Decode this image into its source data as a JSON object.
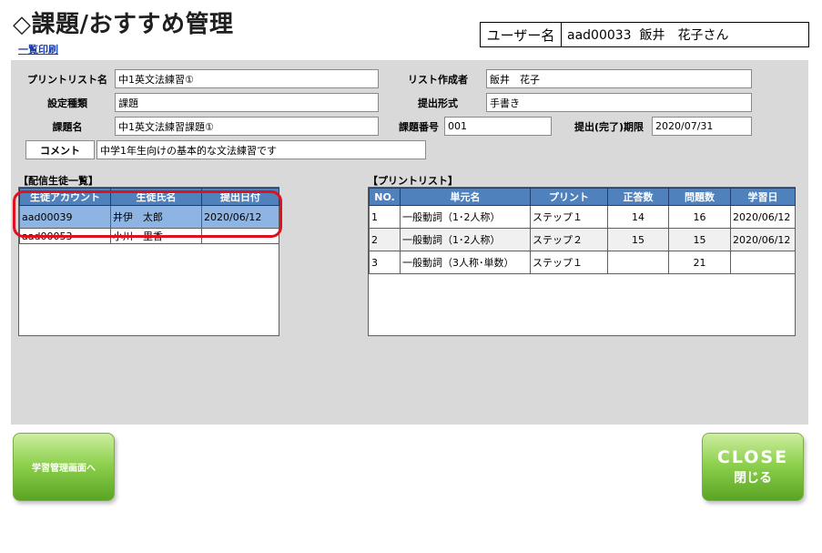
{
  "header": {
    "title": "◇課題/おすすめ管理",
    "print_link": "一覧印刷"
  },
  "user": {
    "label": "ユーザー名",
    "value": "aad00033  飯井　花子さん"
  },
  "form": {
    "print_list_name": {
      "label": "プリントリスト名",
      "value": "中1英文法練習①"
    },
    "creator": {
      "label": "リスト作成者",
      "value": "飯井　花子"
    },
    "setting_type": {
      "label": "設定種類",
      "value": "課題"
    },
    "submit_format": {
      "label": "提出形式",
      "value": "手書き"
    },
    "task_name": {
      "label": "課題名",
      "value": "中1英文法練習課題①"
    },
    "task_number": {
      "label": "課題番号",
      "value": "001"
    },
    "deadline": {
      "label": "提出(完了)期限",
      "value": "2020/07/31"
    },
    "comment": {
      "label": "コメント",
      "value": "中学1年生向けの基本的な文法練習です"
    }
  },
  "students": {
    "section_label": "【配信生徒一覧】",
    "headers": [
      "生徒アカウント",
      "生徒氏名",
      "提出日付"
    ],
    "rows": [
      [
        "aad00039",
        "井伊　太郎",
        "2020/06/12"
      ],
      [
        "aad00053",
        "小川　里香",
        ""
      ]
    ],
    "selected_index": 0
  },
  "print_list": {
    "section_label": "【プリントリスト】",
    "headers": [
      "NO.",
      "単元名",
      "プリント",
      "正答数",
      "問題数",
      "学習日"
    ],
    "rows": [
      [
        "1",
        "一般動詞（1･2人称）",
        "ステップ１",
        "14",
        "16",
        "2020/06/12"
      ],
      [
        "2",
        "一般動詞（1･2人称）",
        "ステップ２",
        "15",
        "15",
        "2020/06/12"
      ],
      [
        "3",
        "一般動詞（3人称･単数）",
        "ステップ１",
        "",
        "21",
        ""
      ]
    ]
  },
  "buttons": {
    "study_management": "学習管理画面へ",
    "close_en": "CLOSE",
    "close_jp": "閉じる"
  },
  "colors": {
    "header_blue": "#4f81bd",
    "selected_row": "#8db4e2",
    "highlight_red": "#e0101e",
    "panel_gray": "#d9d9d9",
    "button_green": "#8fd14f"
  }
}
